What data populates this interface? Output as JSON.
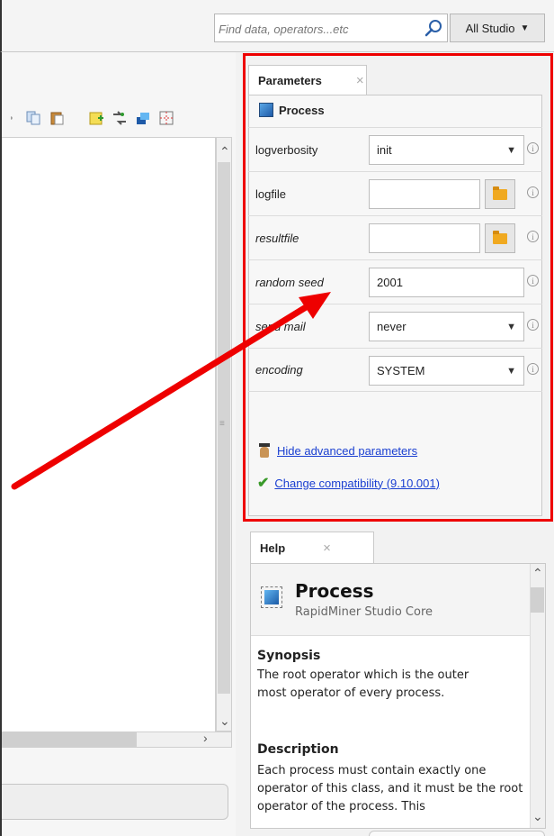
{
  "search": {
    "placeholder": "Find data, operators...etc",
    "scope_label": "All Studio"
  },
  "parameters_panel": {
    "tab_label": "Parameters",
    "close_glyph": "×",
    "operator_name": "Process",
    "rows": [
      {
        "label": "logverbosity",
        "value": "init",
        "kind": "select"
      },
      {
        "label": "logfile",
        "value": "",
        "kind": "file"
      },
      {
        "label": "resultfile",
        "value": "",
        "kind": "file"
      },
      {
        "label": "random seed",
        "value": "2001",
        "kind": "text"
      },
      {
        "label": "send mail",
        "value": "never",
        "kind": "select"
      },
      {
        "label": "encoding",
        "value": "SYSTEM",
        "kind": "select"
      }
    ],
    "hide_advanced_label": "Hide advanced parameters",
    "compatibility_label": "Change compatibility (9.10.001)"
  },
  "help_panel": {
    "tab_label": "Help",
    "close_glyph": "×",
    "title": "Process",
    "subtitle": "RapidMiner Studio Core",
    "synopsis_heading": "Synopsis",
    "synopsis_text": "The root operator which is the outer most operator of every process.",
    "description_heading": "Description",
    "description_text": "Each process must contain exactly one operator of this class, and it must be the root operator of the process. This"
  },
  "colors": {
    "highlight": "#ee0000",
    "link": "#1a3fd1",
    "accent_blue": "#1e5aa8"
  }
}
